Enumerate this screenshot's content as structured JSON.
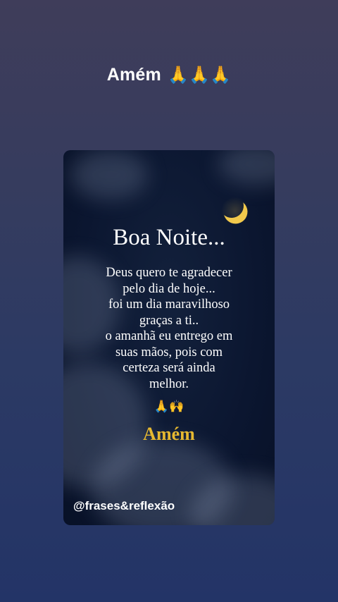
{
  "caption": {
    "text": "Amém",
    "emoji": "🙏🙏🙏"
  },
  "card": {
    "moon_icon": "crescent-moon-icon",
    "title": "Boa Noite...",
    "message_lines": [
      "Deus quero te agradecer",
      "pelo dia de hoje...",
      "foi um dia maravilhoso",
      "graças a ti..",
      "o amanhã eu entrego em",
      "suas mãos, pois com",
      "certeza será ainda",
      "melhor."
    ],
    "hands_emoji": "🙏🙌",
    "closing": "Amém",
    "handle": "@frases&reflexão"
  },
  "colors": {
    "background_top": "#3f3d5a",
    "background_bottom": "#233467",
    "card_background": "#0b1630",
    "gold": "#e6b830",
    "moon": "#f2c94c"
  }
}
